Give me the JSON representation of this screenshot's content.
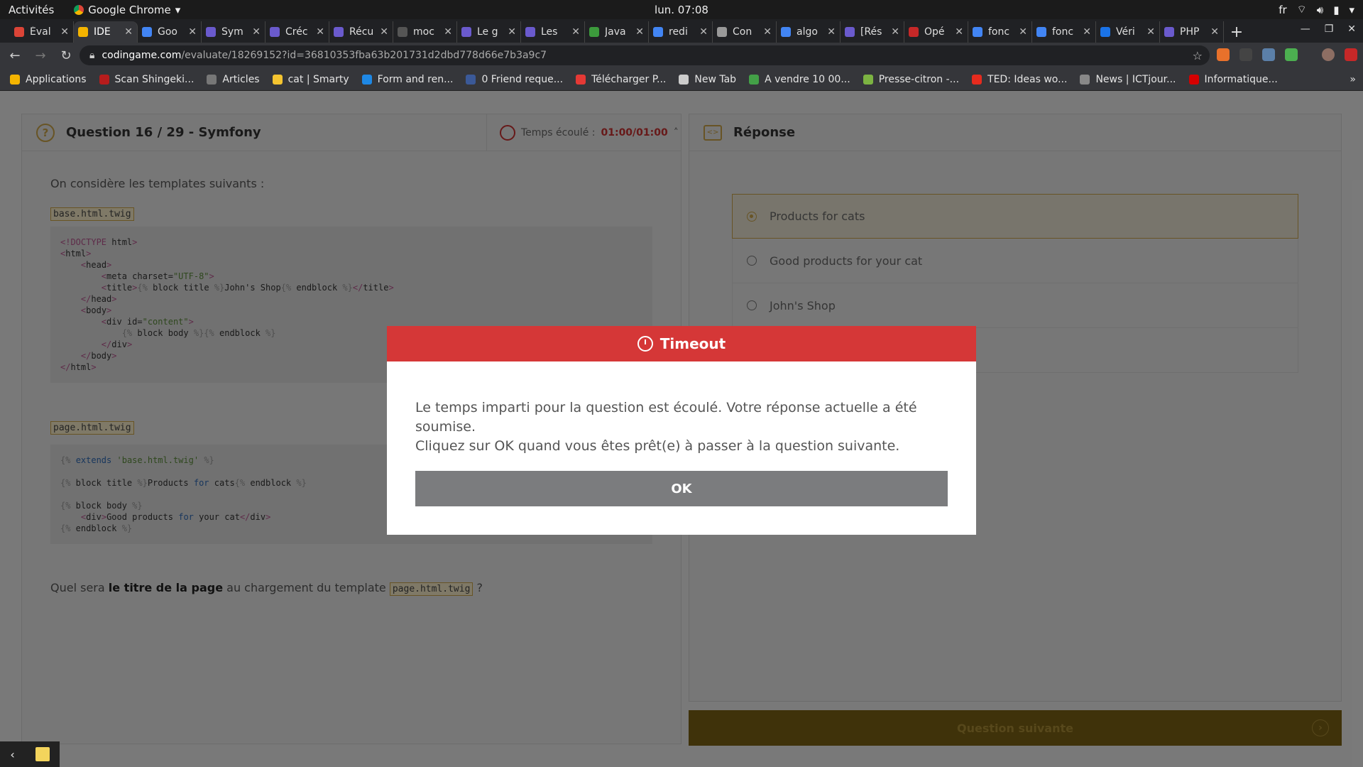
{
  "system_bar": {
    "activities": "Activités",
    "app_name": "Google Chrome",
    "clock": "lun. 07:08",
    "lang": "fr"
  },
  "tabs": [
    {
      "title": "Éval",
      "color": "#db4437"
    },
    {
      "title": "IDE",
      "color": "#f4b400",
      "active": true
    },
    {
      "title": "Goo",
      "color": "#4285f4"
    },
    {
      "title": "Sym",
      "color": "#6a5acd"
    },
    {
      "title": "Créc",
      "color": "#6a5acd"
    },
    {
      "title": "Récu",
      "color": "#6a5acd"
    },
    {
      "title": "moc",
      "color": "#555555"
    },
    {
      "title": "Le g",
      "color": "#6a5acd"
    },
    {
      "title": "Les",
      "color": "#6a5acd"
    },
    {
      "title": "Java",
      "color": "#3c9a3c"
    },
    {
      "title": "redi",
      "color": "#4285f4"
    },
    {
      "title": "Con",
      "color": "#999999"
    },
    {
      "title": "algo",
      "color": "#4285f4"
    },
    {
      "title": "[Rés",
      "color": "#6a5acd"
    },
    {
      "title": "Opé",
      "color": "#c62828"
    },
    {
      "title": "fonc",
      "color": "#4285f4"
    },
    {
      "title": "fonc",
      "color": "#4285f4"
    },
    {
      "title": "Véri",
      "color": "#1a73e8"
    },
    {
      "title": "PHP",
      "color": "#6a5acd"
    }
  ],
  "address_bar": {
    "host": "codingame.com",
    "path": "/evaluate/18269152?id=36810353fba63b201731d2dbd778d66e7b3a9c7"
  },
  "bookmarks": [
    {
      "label": "Applications",
      "color": "#f4b400"
    },
    {
      "label": "Scan Shingeki...",
      "color": "#b71c1c"
    },
    {
      "label": "Articles",
      "color": "#777777"
    },
    {
      "label": "cat | Smarty",
      "color": "#f4c430"
    },
    {
      "label": "Form and ren...",
      "color": "#1e88e5"
    },
    {
      "label": "0 Friend reque...",
      "color": "#3b5998"
    },
    {
      "label": "Télécharger P...",
      "color": "#e53935"
    },
    {
      "label": "New Tab",
      "color": "#cccccc"
    },
    {
      "label": "A vendre 10 00...",
      "color": "#43a047"
    },
    {
      "label": "Presse-citron -...",
      "color": "#7cb342"
    },
    {
      "label": "TED: Ideas wo...",
      "color": "#e62b1e"
    },
    {
      "label": "News | ICTjour...",
      "color": "#888888"
    },
    {
      "label": "Informatique...",
      "color": "#d50000"
    }
  ],
  "question": {
    "title": "Question 16 / 29 - Symfony",
    "timer_label": "Temps écoulé :",
    "timer_value": "01:00/01:00",
    "intro": "On considère les templates suivants :",
    "file1": "base.html.twig",
    "file2": "page.html.twig",
    "prompt_before": "Quel sera",
    "prompt_bold": "le titre de la page",
    "prompt_after": "au chargement du template",
    "prompt_file": "page.html.twig",
    "prompt_end": "?"
  },
  "answer": {
    "title": "Réponse",
    "options": [
      {
        "label": "Products for cats",
        "selected": true
      },
      {
        "label": "Good products for your cat",
        "selected": false
      },
      {
        "label": "John's Shop",
        "selected": false
      },
      {
        "label": "",
        "selected": false
      }
    ],
    "next_label": "Question suivante"
  },
  "modal": {
    "title": "Timeout",
    "line1": "Le temps imparti pour la question est écoulé. Votre réponse actuelle a été soumise.",
    "line2": "Cliquez sur OK quand vous êtes prêt(e) à passer à la question suivante.",
    "ok_label": "OK"
  }
}
